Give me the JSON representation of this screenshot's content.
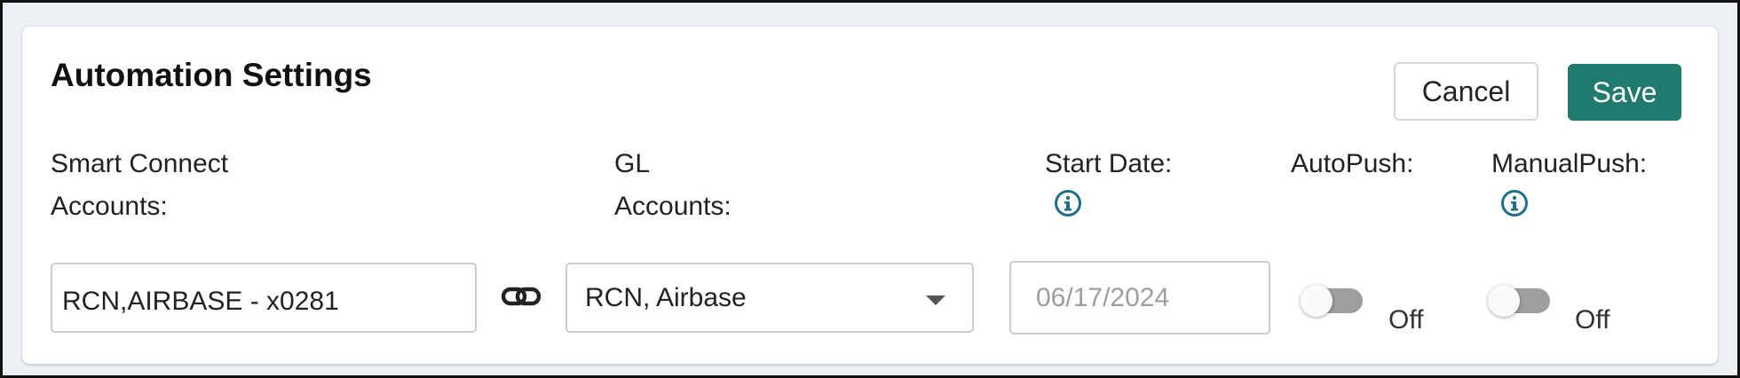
{
  "card": {
    "title": "Automation Settings",
    "cancel_label": "Cancel",
    "save_label": "Save"
  },
  "labels": {
    "smart_connect_line1": "Smart Connect",
    "smart_connect_line2": "Accounts:",
    "gl_line1": "GL",
    "gl_line2": "Accounts:",
    "start_date": "Start Date:",
    "autopush": "AutoPush:",
    "manualpush": "ManualPush:"
  },
  "fields": {
    "smart_connect_value": "RCN,AIRBASE - x0281",
    "gl_selected": "RCN, Airbase",
    "start_date_placeholder": "06/17/2024"
  },
  "toggles": {
    "autopush_state": "Off",
    "manualpush_state": "Off"
  },
  "icons": {
    "info": "info-circle-icon",
    "link": "link-icon",
    "dropdown": "caret-down-icon"
  },
  "colors": {
    "primary": "#207a6e",
    "info": "#1f6e8c",
    "toggle_off": "#9e9e9e"
  }
}
